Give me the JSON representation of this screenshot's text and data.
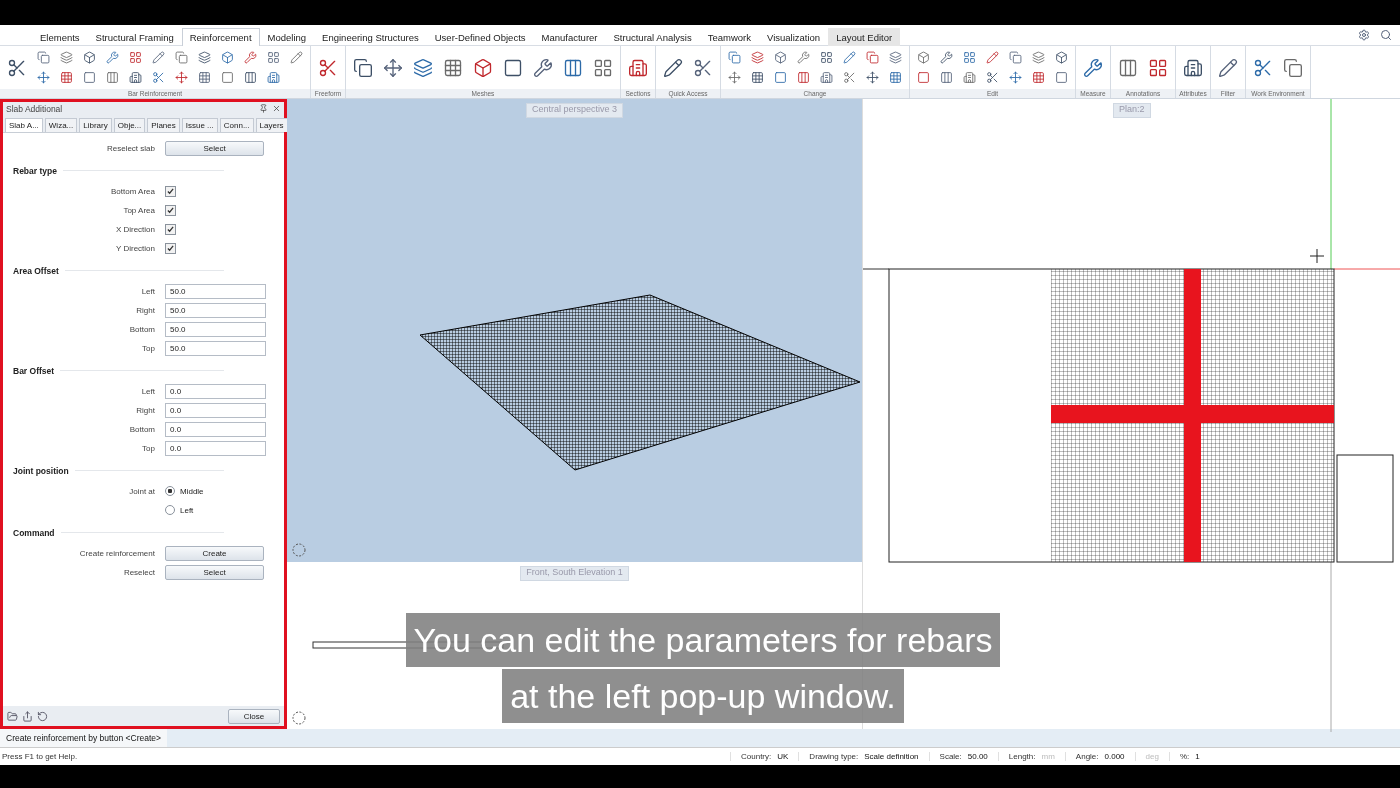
{
  "ribbon_tabs": [
    {
      "label": "Elements",
      "selected": false,
      "hovered": false
    },
    {
      "label": "Structural Framing",
      "selected": false,
      "hovered": false
    },
    {
      "label": "Reinforcement",
      "selected": true,
      "hovered": false
    },
    {
      "label": "Modeling",
      "selected": false,
      "hovered": false
    },
    {
      "label": "Engineering Structures",
      "selected": false,
      "hovered": false
    },
    {
      "label": "User-Defined Objects",
      "selected": false,
      "hovered": false
    },
    {
      "label": "Manufacturer",
      "selected": false,
      "hovered": false
    },
    {
      "label": "Structural Analysis",
      "selected": false,
      "hovered": false
    },
    {
      "label": "Teamwork",
      "selected": false,
      "hovered": false
    },
    {
      "label": "Visualization",
      "selected": false,
      "hovered": false
    },
    {
      "label": "Layout Editor",
      "selected": false,
      "hovered": true
    }
  ],
  "ribbon_groups": [
    {
      "label": "Bar Reinforcement"
    },
    {
      "label": "Freeform"
    },
    {
      "label": "Meshes"
    },
    {
      "label": "Sections"
    },
    {
      "label": "Quick Access"
    },
    {
      "label": "Change"
    },
    {
      "label": "Edit"
    },
    {
      "label": "Measure"
    },
    {
      "label": "Annotations"
    },
    {
      "label": "Attributes"
    },
    {
      "label": "Filter"
    },
    {
      "label": "Work Environment"
    }
  ],
  "panel": {
    "title": "Slab Additional",
    "tabs": [
      {
        "label": "Slab A...",
        "selected": true
      },
      {
        "label": "Wiza...",
        "selected": false
      },
      {
        "label": "Library",
        "selected": false
      },
      {
        "label": "Obje...",
        "selected": false
      },
      {
        "label": "Planes",
        "selected": false
      },
      {
        "label": "Issue ...",
        "selected": false
      },
      {
        "label": "Conn...",
        "selected": false
      },
      {
        "label": "Layers",
        "selected": false
      }
    ],
    "sections": [
      {
        "rows": [
          {
            "kind": "button",
            "label": "Reselect slab",
            "value": "Select"
          }
        ]
      },
      {
        "heading": "Rebar type",
        "rows": [
          {
            "kind": "checkbox",
            "label": "Bottom Area",
            "checked": true
          },
          {
            "kind": "checkbox",
            "label": "Top Area",
            "checked": true
          },
          {
            "kind": "checkbox",
            "label": "X Direction",
            "checked": true
          },
          {
            "kind": "checkbox",
            "label": "Y Direction",
            "checked": true
          }
        ]
      },
      {
        "heading": "Area Offset",
        "rows": [
          {
            "kind": "input",
            "label": "Left",
            "value": "50.0"
          },
          {
            "kind": "input",
            "label": "Right",
            "value": "50.0"
          },
          {
            "kind": "input",
            "label": "Bottom",
            "value": "50.0"
          },
          {
            "kind": "input",
            "label": "Top",
            "value": "50.0"
          }
        ]
      },
      {
        "heading": "Bar Offset",
        "rows": [
          {
            "kind": "input",
            "label": "Left",
            "value": "0.0"
          },
          {
            "kind": "input",
            "label": "Right",
            "value": "0.0"
          },
          {
            "kind": "input",
            "label": "Bottom",
            "value": "0.0"
          },
          {
            "kind": "input",
            "label": "Top",
            "value": "0.0"
          }
        ]
      },
      {
        "heading": "Joint position",
        "rows": [
          {
            "kind": "radio",
            "label": "Joint at",
            "value": "Middle",
            "selected": true
          },
          {
            "kind": "radio",
            "value": "Left",
            "selected": false
          }
        ]
      },
      {
        "heading": "Command",
        "rows": [
          {
            "kind": "button",
            "label": "Create reinforcement",
            "value": "Create"
          },
          {
            "kind": "button",
            "label": "Reselect",
            "value": "Select"
          }
        ]
      }
    ],
    "close_button": "Close"
  },
  "viewports": {
    "perspective": "Central perspective 3",
    "elevation": "Front, South Elevation 1",
    "plan": "Plan:2"
  },
  "subtitle": [
    "You can edit the parameters for rebars",
    "at the left pop-up window."
  ],
  "command_line": "Create reinforcement by button <Create>",
  "status_bar": {
    "help": "Press F1 to get Help.",
    "fields": [
      {
        "label": "Country:",
        "value": "UK",
        "disabled": false
      },
      {
        "label": "Drawing type:",
        "value": "Scale definition",
        "disabled": false
      },
      {
        "label": "Scale:",
        "value": "50.00",
        "disabled": false
      },
      {
        "label": "Length:",
        "value": "mm",
        "disabled": true
      },
      {
        "label": "Angle:",
        "value": "0.000",
        "disabled": false
      },
      {
        "value": "deg",
        "disabled": true
      },
      {
        "label": "%:",
        "value": "1",
        "disabled": false
      }
    ]
  }
}
